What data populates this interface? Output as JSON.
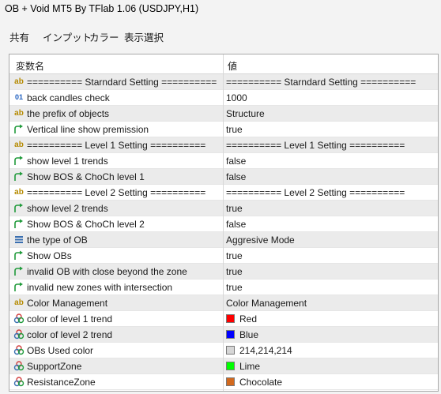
{
  "window": {
    "title": "OB + Void MT5 By TFlab 1.06 (USDJPY,H1)"
  },
  "tabs": [
    {
      "label": "共有",
      "active": false
    },
    {
      "label": "インプット",
      "active": true
    },
    {
      "label": "カラー",
      "active": false
    },
    {
      "label": "表示選択",
      "active": false
    }
  ],
  "grid": {
    "col_name": "変数名",
    "col_value": "値",
    "rows": [
      {
        "icon": "ab-string-icon",
        "name": "========== Starndard Setting ==========",
        "value": "========== Starndard Setting =========="
      },
      {
        "icon": "number-icon",
        "name": "back candles check",
        "value": "1000"
      },
      {
        "icon": "ab-string-icon",
        "name": "the prefix of objects",
        "value": "Structure"
      },
      {
        "icon": "bool-arrow-icon",
        "name": "Vertical line show premission",
        "value": "true"
      },
      {
        "icon": "ab-string-icon",
        "name": "========== Level 1 Setting ==========",
        "value": "========== Level 1 Setting =========="
      },
      {
        "icon": "bool-arrow-icon",
        "name": "show level 1 trends",
        "value": "false"
      },
      {
        "icon": "bool-arrow-icon",
        "name": "Show BOS & ChoCh level 1",
        "value": "false"
      },
      {
        "icon": "ab-string-icon",
        "name": "========== Level 2 Setting ==========",
        "value": "========== Level 2 Setting =========="
      },
      {
        "icon": "bool-arrow-icon",
        "name": "show level 2 trends",
        "value": "true"
      },
      {
        "icon": "bool-arrow-icon",
        "name": "Show BOS & ChoCh level 2",
        "value": "false"
      },
      {
        "icon": "enum-list-icon",
        "name": "the type of OB",
        "value": "Aggresive Mode"
      },
      {
        "icon": "bool-arrow-icon",
        "name": "Show OBs",
        "value": "true"
      },
      {
        "icon": "bool-arrow-icon",
        "name": "invalid OB with close beyond the zone",
        "value": "true"
      },
      {
        "icon": "bool-arrow-icon",
        "name": "invalid new zones with intersection",
        "value": "true"
      },
      {
        "icon": "ab-string-icon",
        "name": "Color Management",
        "value": "Color Management"
      },
      {
        "icon": "color-palette-icon",
        "name": "color of level 1 trend",
        "value": "Red",
        "swatch": "#ff0000"
      },
      {
        "icon": "color-palette-icon",
        "name": "color of level 2 trend",
        "value": "Blue",
        "swatch": "#0000ff"
      },
      {
        "icon": "color-palette-icon",
        "name": "OBs Used color",
        "value": "214,214,214",
        "swatch": "#d6d6d6"
      },
      {
        "icon": "color-palette-icon",
        "name": "SupportZone",
        "value": "Lime",
        "swatch": "#00ff00"
      },
      {
        "icon": "color-palette-icon",
        "name": "ResistanceZone",
        "value": "Chocolate",
        "swatch": "#d2691e"
      }
    ]
  },
  "colors": {
    "accent": "#1f5fbf",
    "alt_row": "#ebebeb",
    "string_icon": "#b58a00",
    "bool_icon": "#1f9a3a"
  }
}
